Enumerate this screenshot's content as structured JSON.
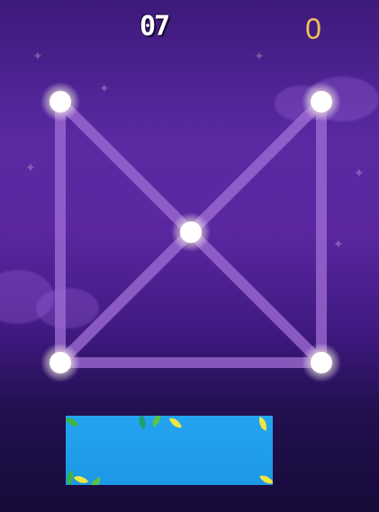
{
  "hud": {
    "level": "07",
    "score": "0"
  },
  "colors": {
    "background_top": "#3c1a7a",
    "background_bottom": "#170b3a",
    "edge": "#a26fd6",
    "node": "#ffffff",
    "score": "#f2c15a",
    "ad_banner": "#24a4f0"
  },
  "puzzle": {
    "nodes": [
      {
        "id": "top-left"
      },
      {
        "id": "top-right"
      },
      {
        "id": "center"
      },
      {
        "id": "bottom-left"
      },
      {
        "id": "bottom-right"
      }
    ],
    "edges": [
      [
        "top-left",
        "center"
      ],
      [
        "top-right",
        "center"
      ],
      [
        "center",
        "bottom-left"
      ],
      [
        "center",
        "bottom-right"
      ],
      [
        "top-left",
        "bottom-left"
      ],
      [
        "top-right",
        "bottom-right"
      ],
      [
        "bottom-left",
        "bottom-right"
      ]
    ],
    "drawn_edges": []
  }
}
